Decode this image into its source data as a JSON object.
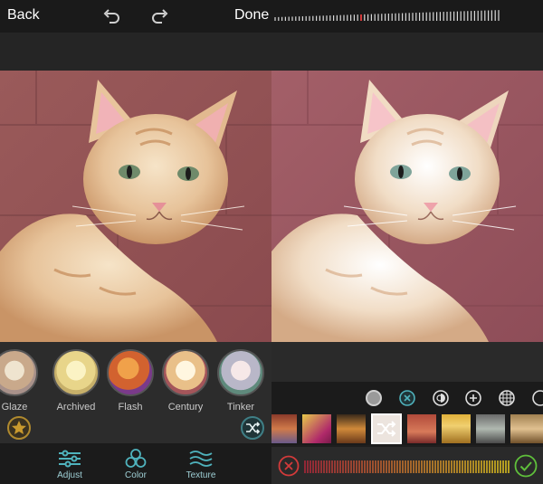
{
  "left": {
    "header": {
      "back_label": "Back",
      "done_label": "Done"
    },
    "filters": [
      {
        "label": "Glaze"
      },
      {
        "label": "Archived"
      },
      {
        "label": "Flash"
      },
      {
        "label": "Century"
      },
      {
        "label": "Tinker"
      }
    ],
    "tabs": [
      {
        "label": "Adjust"
      },
      {
        "label": "Color"
      },
      {
        "label": "Texture"
      }
    ]
  },
  "right": {
    "slider_level": 0.5,
    "tools": [
      "solid-circle-icon",
      "close-circle-icon",
      "half-circle-icon",
      "plus-circle-icon",
      "grid-circle-icon",
      "more-circle-icon"
    ],
    "selected_texture_index": 3
  },
  "colors": {
    "accent": "#4fb3bd",
    "star": "#c99a2e",
    "cancel": "#d23a3a",
    "confirm": "#5fbf3b"
  }
}
